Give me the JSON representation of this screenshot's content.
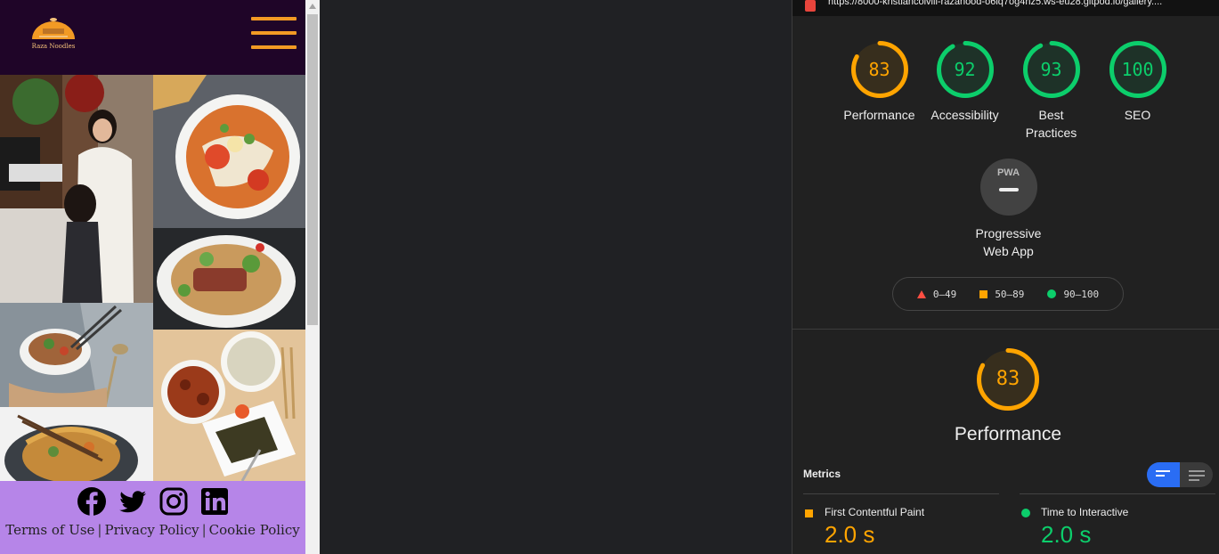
{
  "site": {
    "logo_text": "Raza Noodles",
    "footer": {
      "social": [
        "facebook-icon",
        "twitter-icon",
        "instagram-icon",
        "linkedin-icon"
      ],
      "links": [
        "Terms of Use",
        "Privacy Policy",
        "Cookie Policy"
      ],
      "separator": "|"
    }
  },
  "lighthouse": {
    "url": "https://8000-kristiancolvill-razanood-o6lq7og4hz5.ws-eu28.gitpod.io/gallery....",
    "categories": [
      {
        "label": "Performance",
        "score": 83,
        "color": "#ffa400"
      },
      {
        "label": "Accessibility",
        "score": 92,
        "color": "#0cce6b"
      },
      {
        "label": "Best Practices",
        "score": 93,
        "color": "#0cce6b"
      },
      {
        "label": "SEO",
        "score": 100,
        "color": "#0cce6b"
      }
    ],
    "pwa": {
      "badge": "PWA",
      "label": "Progressive Web App"
    },
    "legend": [
      "0–49",
      "50–89",
      "90–100"
    ],
    "performance": {
      "score": 83,
      "title": "Performance"
    },
    "metrics_title": "Metrics",
    "metrics": [
      {
        "label": "First Contentful Paint",
        "value": "2.0 s",
        "color": "#ffa400"
      },
      {
        "label": "Time to Interactive",
        "value": "2.0 s",
        "color": "#0cce6b"
      }
    ]
  }
}
